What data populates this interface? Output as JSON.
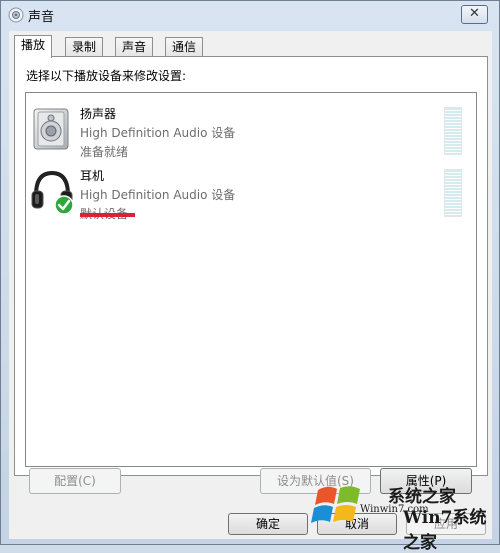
{
  "window": {
    "title": "声音",
    "close_glyph": "✕"
  },
  "tabs": [
    {
      "label": "播放",
      "active": true
    },
    {
      "label": "录制",
      "active": false
    },
    {
      "label": "声音",
      "active": false
    },
    {
      "label": "通信",
      "active": false
    }
  ],
  "panel": {
    "instruction": "选择以下播放设备来修改设置:"
  },
  "devices": [
    {
      "name": "扬声器",
      "description": "High Definition Audio 设备",
      "status": "准备就绪",
      "icon": "speaker-icon"
    },
    {
      "name": "耳机",
      "description": "High Definition Audio 设备",
      "status": "默认设备",
      "icon": "headphones-icon",
      "default": true
    }
  ],
  "buttons": {
    "configure": "配置(C)",
    "set_default": "设为默认值(S)",
    "properties": "属性(P)",
    "ok": "确定",
    "cancel": "取消",
    "apply": "应用"
  },
  "watermark": {
    "brand": "系统之家",
    "url": "Winwin7.com",
    "brand2": "Win7系统之家"
  },
  "colors": {
    "highlight_mark": "#dc1f3b",
    "check": "#2fa83a"
  }
}
